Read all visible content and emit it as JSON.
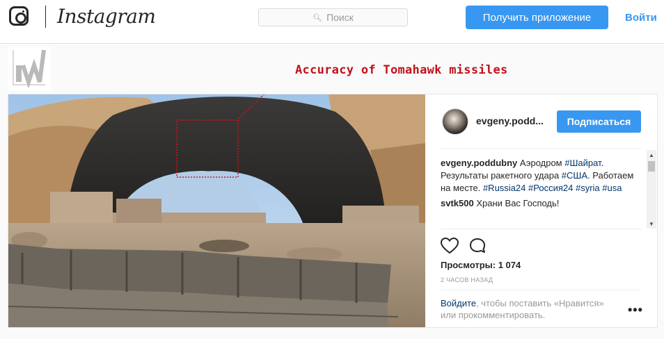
{
  "header": {
    "brand": "Instagram",
    "search_placeholder": "Поиск",
    "get_app_label": "Получить приложение",
    "login_label": "Войти",
    "icons": [
      "instagram-camera-icon",
      "search-icon"
    ]
  },
  "overlay": {
    "annotation": "Accuracy of Tomahawk missiles"
  },
  "post": {
    "username_short": "evgeny.podd...",
    "follow_label": "Подписаться",
    "caption": {
      "author": "evgeny.poddubny",
      "text_1": " Аэродром ",
      "tag_1": "#Шайрат",
      "text_2": ". Результаты ракетного удара ",
      "tag_2": "#США",
      "text_3": ". Работаем на месте. ",
      "tag_3": "#Russia24",
      "tag_4": "#Россия24",
      "tag_5": "#syria",
      "tag_6": "#usa"
    },
    "comment": {
      "author": "svtk500",
      "text": "Храни Вас Господь!"
    },
    "views_label": "Просмотры:",
    "views_count": "1 074",
    "timestamp": "2 часов назад",
    "login_prompt": {
      "link": "Войдите",
      "rest": ", чтобы поставить «Нравится» или прокомментировать."
    },
    "more_label": "•••",
    "icons": [
      "heart-icon",
      "comment-icon",
      "more-options-icon"
    ]
  },
  "colors": {
    "accent_blue": "#3897f0",
    "hashtag_blue": "#003569",
    "annotation_red": "#c1121a"
  }
}
